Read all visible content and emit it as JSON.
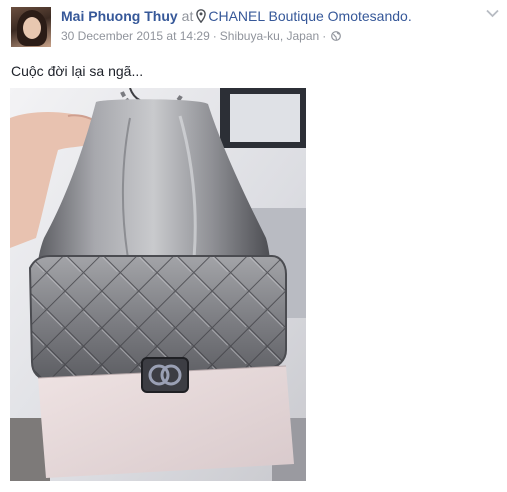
{
  "post": {
    "author": "Mai Phuong Thuy",
    "at_text": "at",
    "location": "CHANEL Boutique Omotesando.",
    "timestamp": "30 December 2015 at 14:29",
    "separator": "·",
    "place": "Shibuya-ku, Japan",
    "privacy_icon": "globe-icon",
    "location_icon": "map-pin-icon",
    "menu_icon": "chevron-down-icon",
    "text": "Cuộc đời lại sa ngã..."
  },
  "colors": {
    "link": "#365899",
    "meta": "#90949c",
    "text": "#1d2129"
  }
}
